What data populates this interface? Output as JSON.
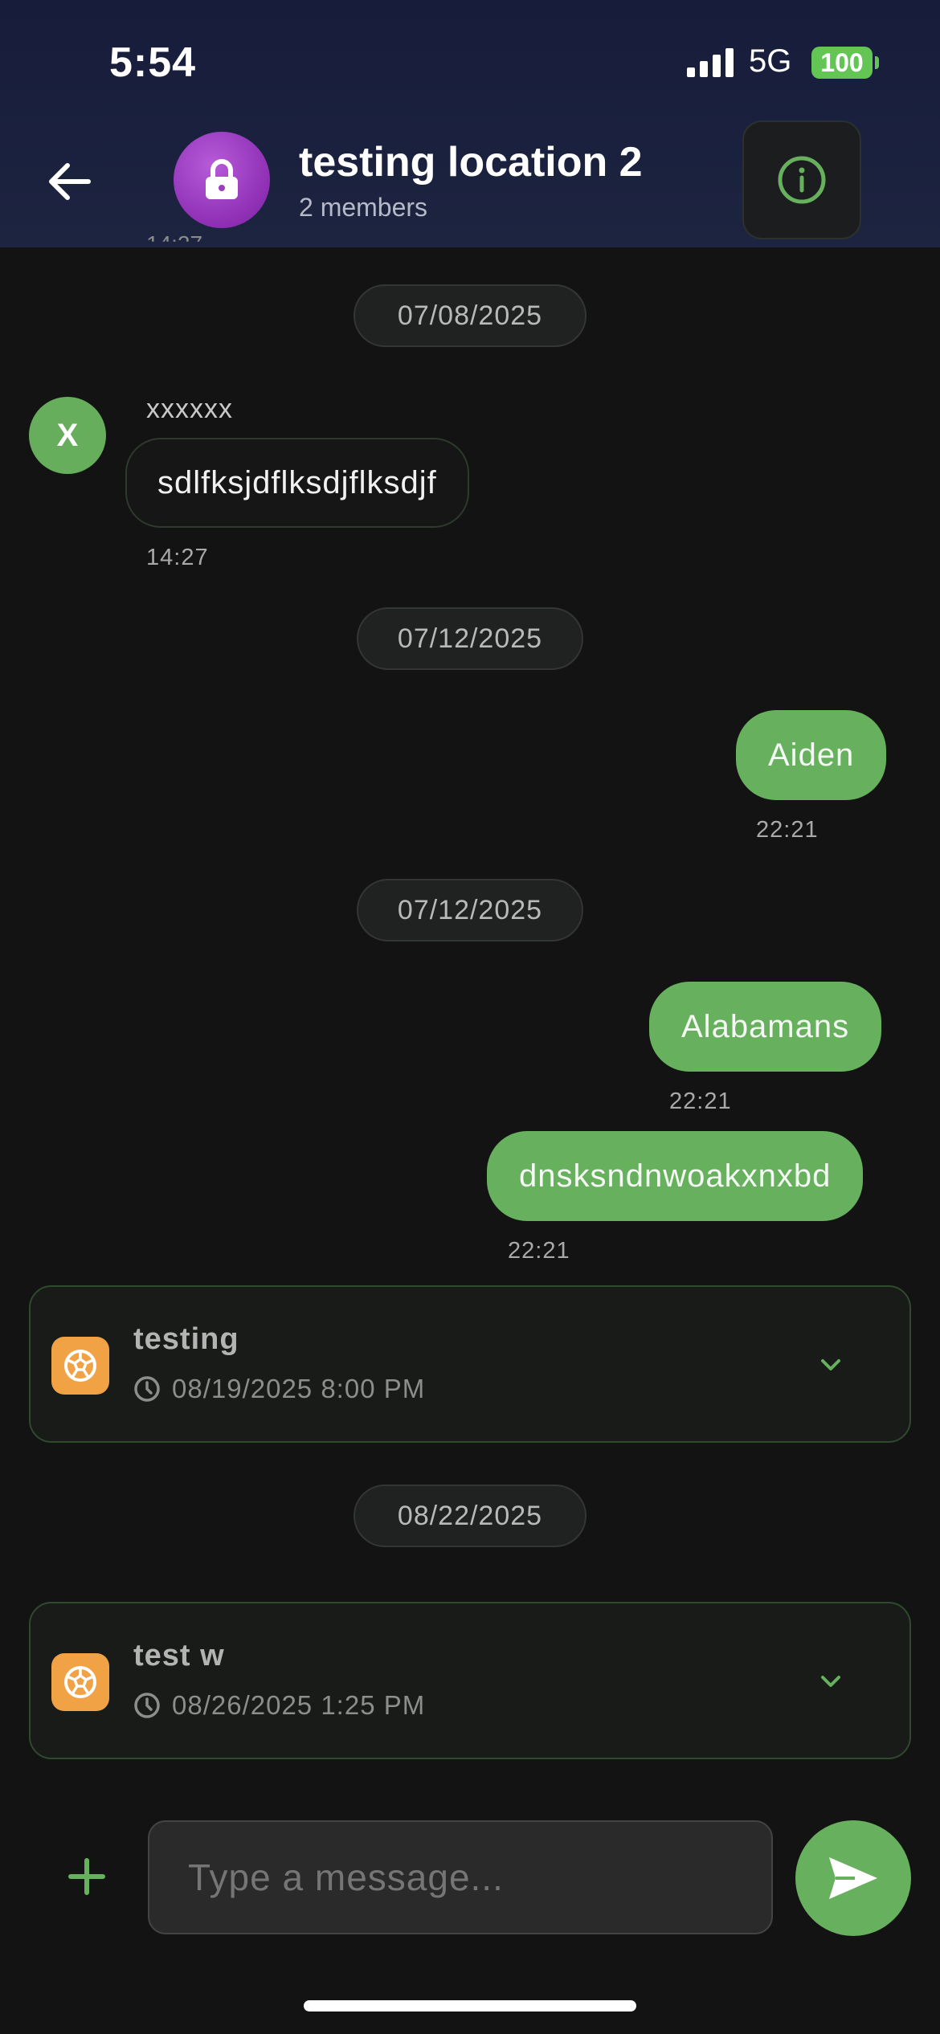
{
  "status_bar": {
    "time": "5:54",
    "network": "5G",
    "battery": "100"
  },
  "header": {
    "title": "testing location 2",
    "subtitle": "2 members",
    "clipped_time": "14:27"
  },
  "icons": {
    "back": "arrow-left-icon",
    "group": "lock-icon",
    "info": "info-circle-icon",
    "event": "soccer-ball-icon",
    "clock": "clock-icon",
    "expand": "chevron-down-icon",
    "attach": "plus-icon",
    "send": "send-icon"
  },
  "colors": {
    "accent": "#67b05d",
    "avatar_purple": "#9b3fc2",
    "event_orange": "#f0a245",
    "background": "#131313",
    "header_bg": "#1a2140"
  },
  "messages": [
    {
      "type": "date",
      "label": "07/08/2025"
    },
    {
      "type": "incoming",
      "avatar": "X",
      "sender": "xxxxxx",
      "text": "sdlfksjdflksdjflksdjf",
      "time": "14:27"
    },
    {
      "type": "date",
      "label": "07/12/2025"
    },
    {
      "type": "outgoing",
      "text": "Aiden",
      "time": "22:21"
    },
    {
      "type": "date",
      "label": "07/12/2025"
    },
    {
      "type": "outgoing",
      "text": "Alabamans",
      "time": "22:21"
    },
    {
      "type": "outgoing",
      "text": "dnsksndnwoakxnxbd",
      "time": "22:21"
    },
    {
      "type": "event",
      "title": "testing",
      "datetime": "08/19/2025 8:00 PM"
    },
    {
      "type": "date",
      "label": "08/22/2025"
    },
    {
      "type": "event",
      "title": "test w",
      "datetime": "08/26/2025 1:25 PM"
    }
  ],
  "composer": {
    "placeholder": "Type a message..."
  }
}
